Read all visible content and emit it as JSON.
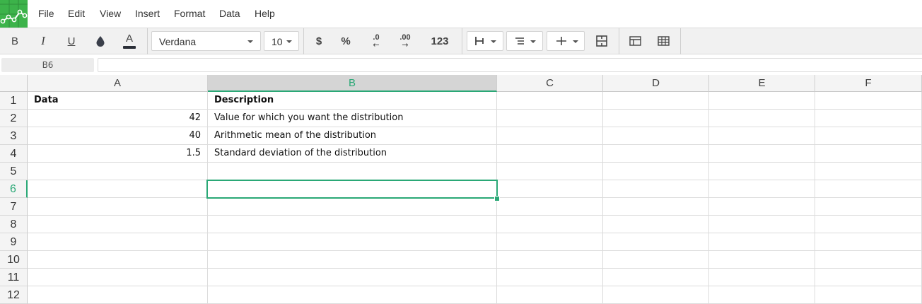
{
  "menu": [
    "File",
    "Edit",
    "View",
    "Insert",
    "Format",
    "Data",
    "Help"
  ],
  "toolbar": {
    "bold": "B",
    "italic": "I",
    "underline": "U",
    "text_color": "A",
    "font_family": "Verdana",
    "font_size": "10",
    "currency": "$",
    "percent": "%",
    "dec_decrease": ".0",
    "dec_increase": ".00",
    "number_format": "123"
  },
  "formula_bar": {
    "name_box": "B6",
    "formula": ""
  },
  "columns": [
    "A",
    "B",
    "C",
    "D",
    "E",
    "F"
  ],
  "selected_column": "B",
  "rows": [
    "1",
    "2",
    "3",
    "4",
    "5",
    "6",
    "7",
    "8",
    "9",
    "10",
    "11",
    "12"
  ],
  "selected_row": "6",
  "cells": {
    "A1": "Data",
    "B1": "Description",
    "A2": "42",
    "B2": "Value for which you want the distribution",
    "A3": "40",
    "B3": "Arithmetic mean of the distribution",
    "A4": "1.5",
    "B4": "Standard deviation of the distribution"
  },
  "colors": {
    "accent": "#2aa876",
    "logo": "#3cb34a"
  }
}
